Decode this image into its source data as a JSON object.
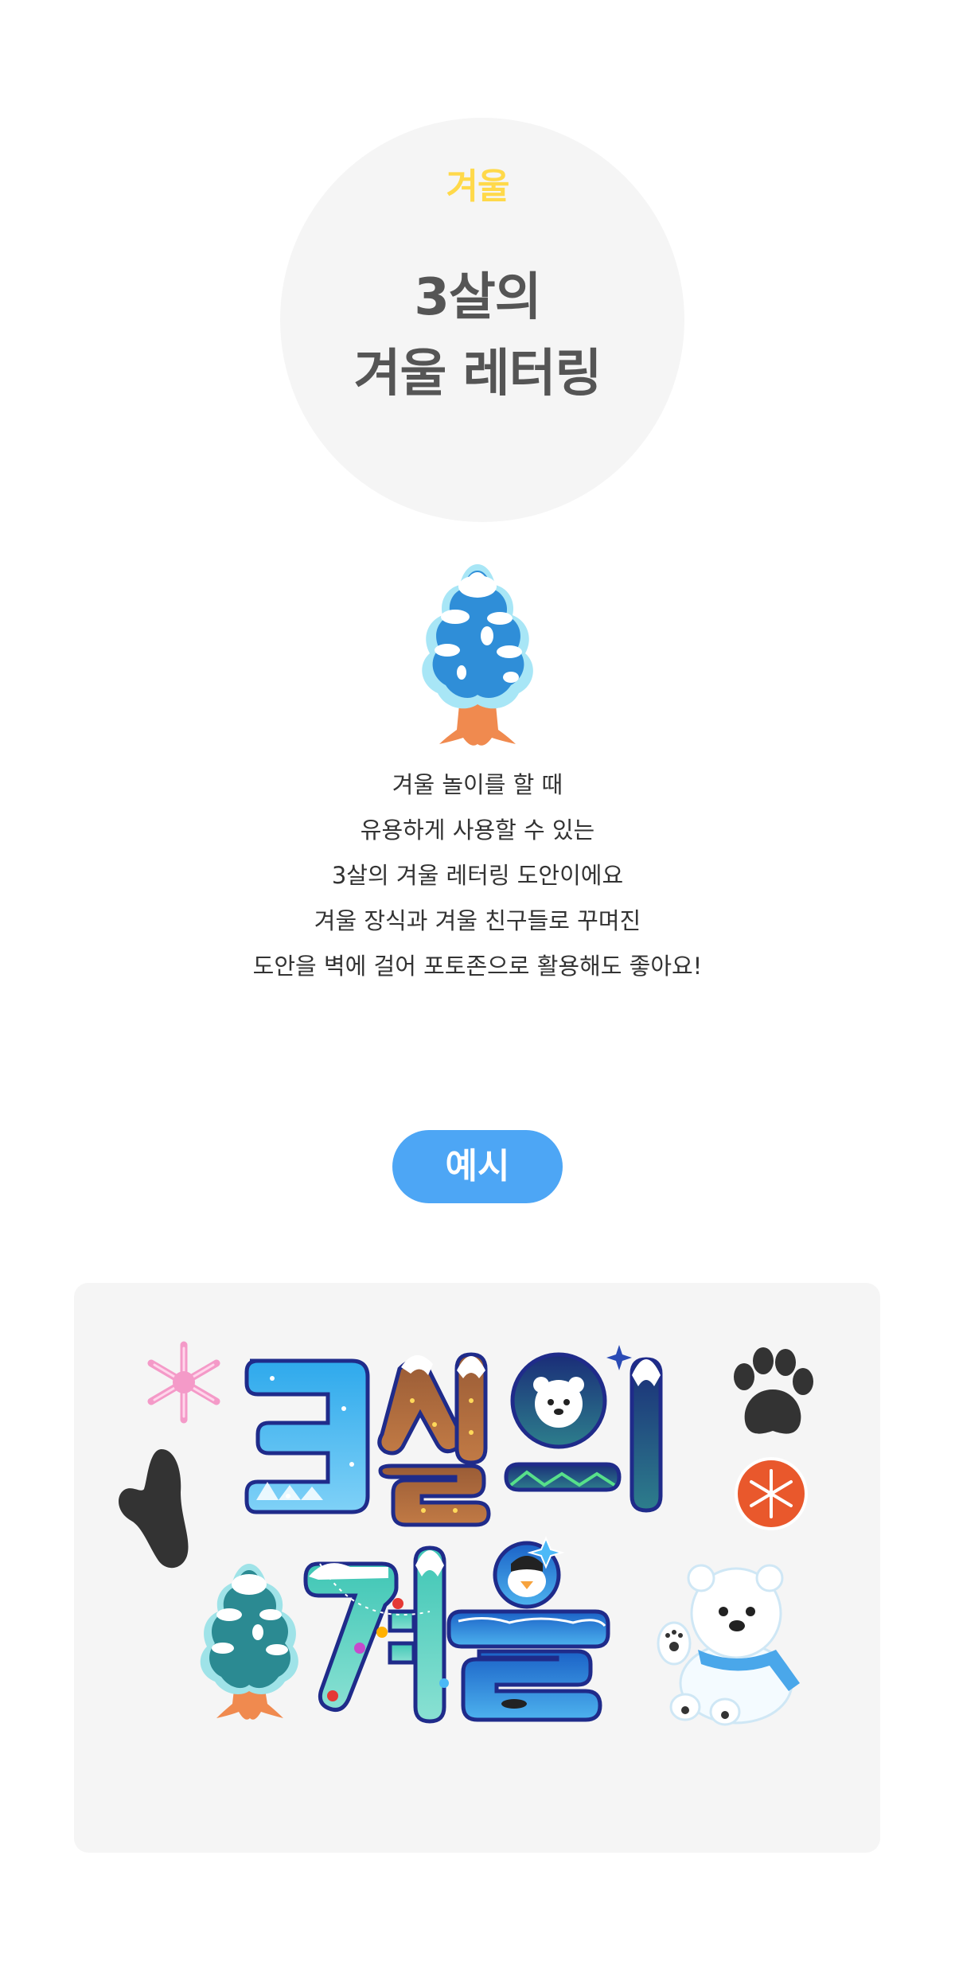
{
  "header": {
    "season": "겨울",
    "title_line1": "3살의",
    "title_line2": "겨울 레터링"
  },
  "description": [
    "겨울 놀이를 할 때",
    "유용하게 사용할 수 있는",
    "3살의 겨울 레터링 도안이에요",
    "겨울 장식과 겨울 친구들로 꾸며진",
    "도안을 벽에 걸어 포토존으로 활용해도 좋아요!"
  ],
  "example": {
    "badge_label": "예시",
    "lettering_line1": "3살의",
    "lettering_line2": "겨울"
  },
  "colors": {
    "accent_yellow": "#ffd94a",
    "title_gray": "#555555",
    "pill_blue": "#4da6f5",
    "panel_bg": "#f5f5f5"
  },
  "icons": [
    "snow-tree-icon",
    "snowflake-icon",
    "paw-print-icon",
    "footprint-icon",
    "polar-bear-icon",
    "penguin-icon",
    "orange-ornament-icon"
  ]
}
